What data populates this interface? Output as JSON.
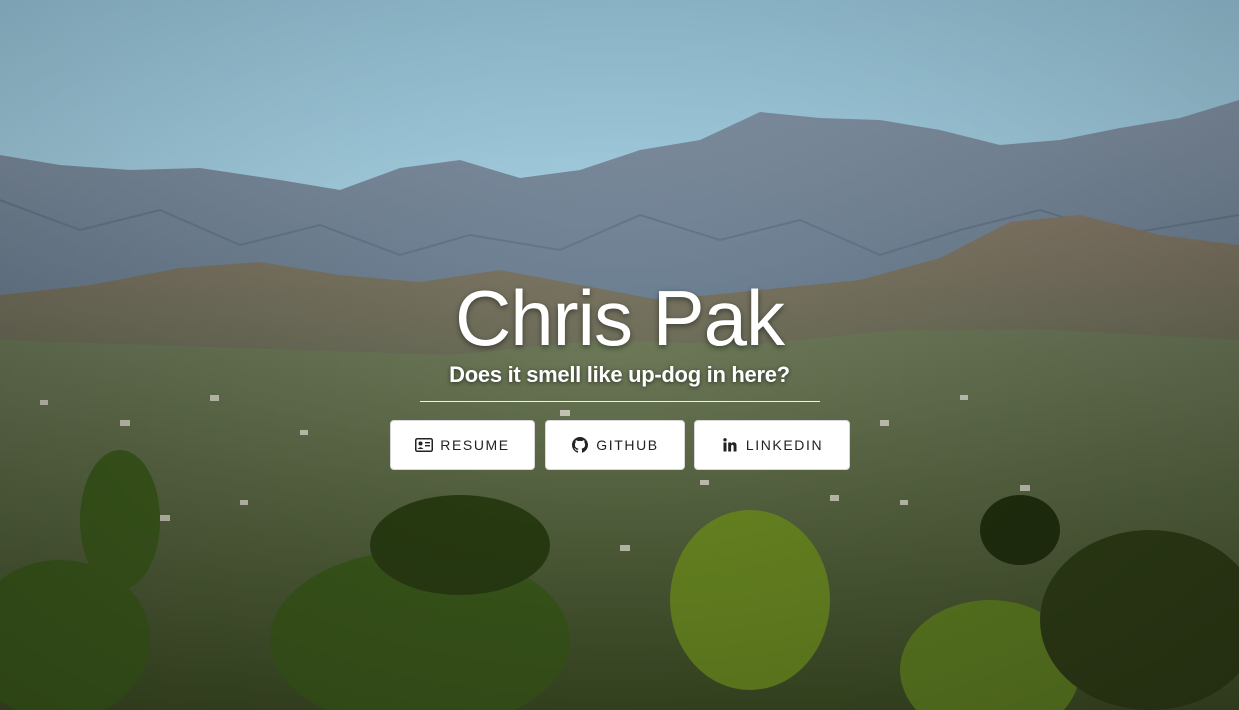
{
  "hero": {
    "name": "Chris Pak",
    "tagline": "Does it smell like up-dog in here?"
  },
  "buttons": [
    {
      "label": "RESUME",
      "icon": "id-card-icon"
    },
    {
      "label": "GITHUB",
      "icon": "github-icon"
    },
    {
      "label": "LINKEDIN",
      "icon": "linkedin-icon"
    }
  ],
  "colors": {
    "sky": "#a9dcef",
    "mountain": "#7f93a8",
    "foliage": "#4f6a2a",
    "button_bg": "#ffffff",
    "button_text": "#222222"
  }
}
